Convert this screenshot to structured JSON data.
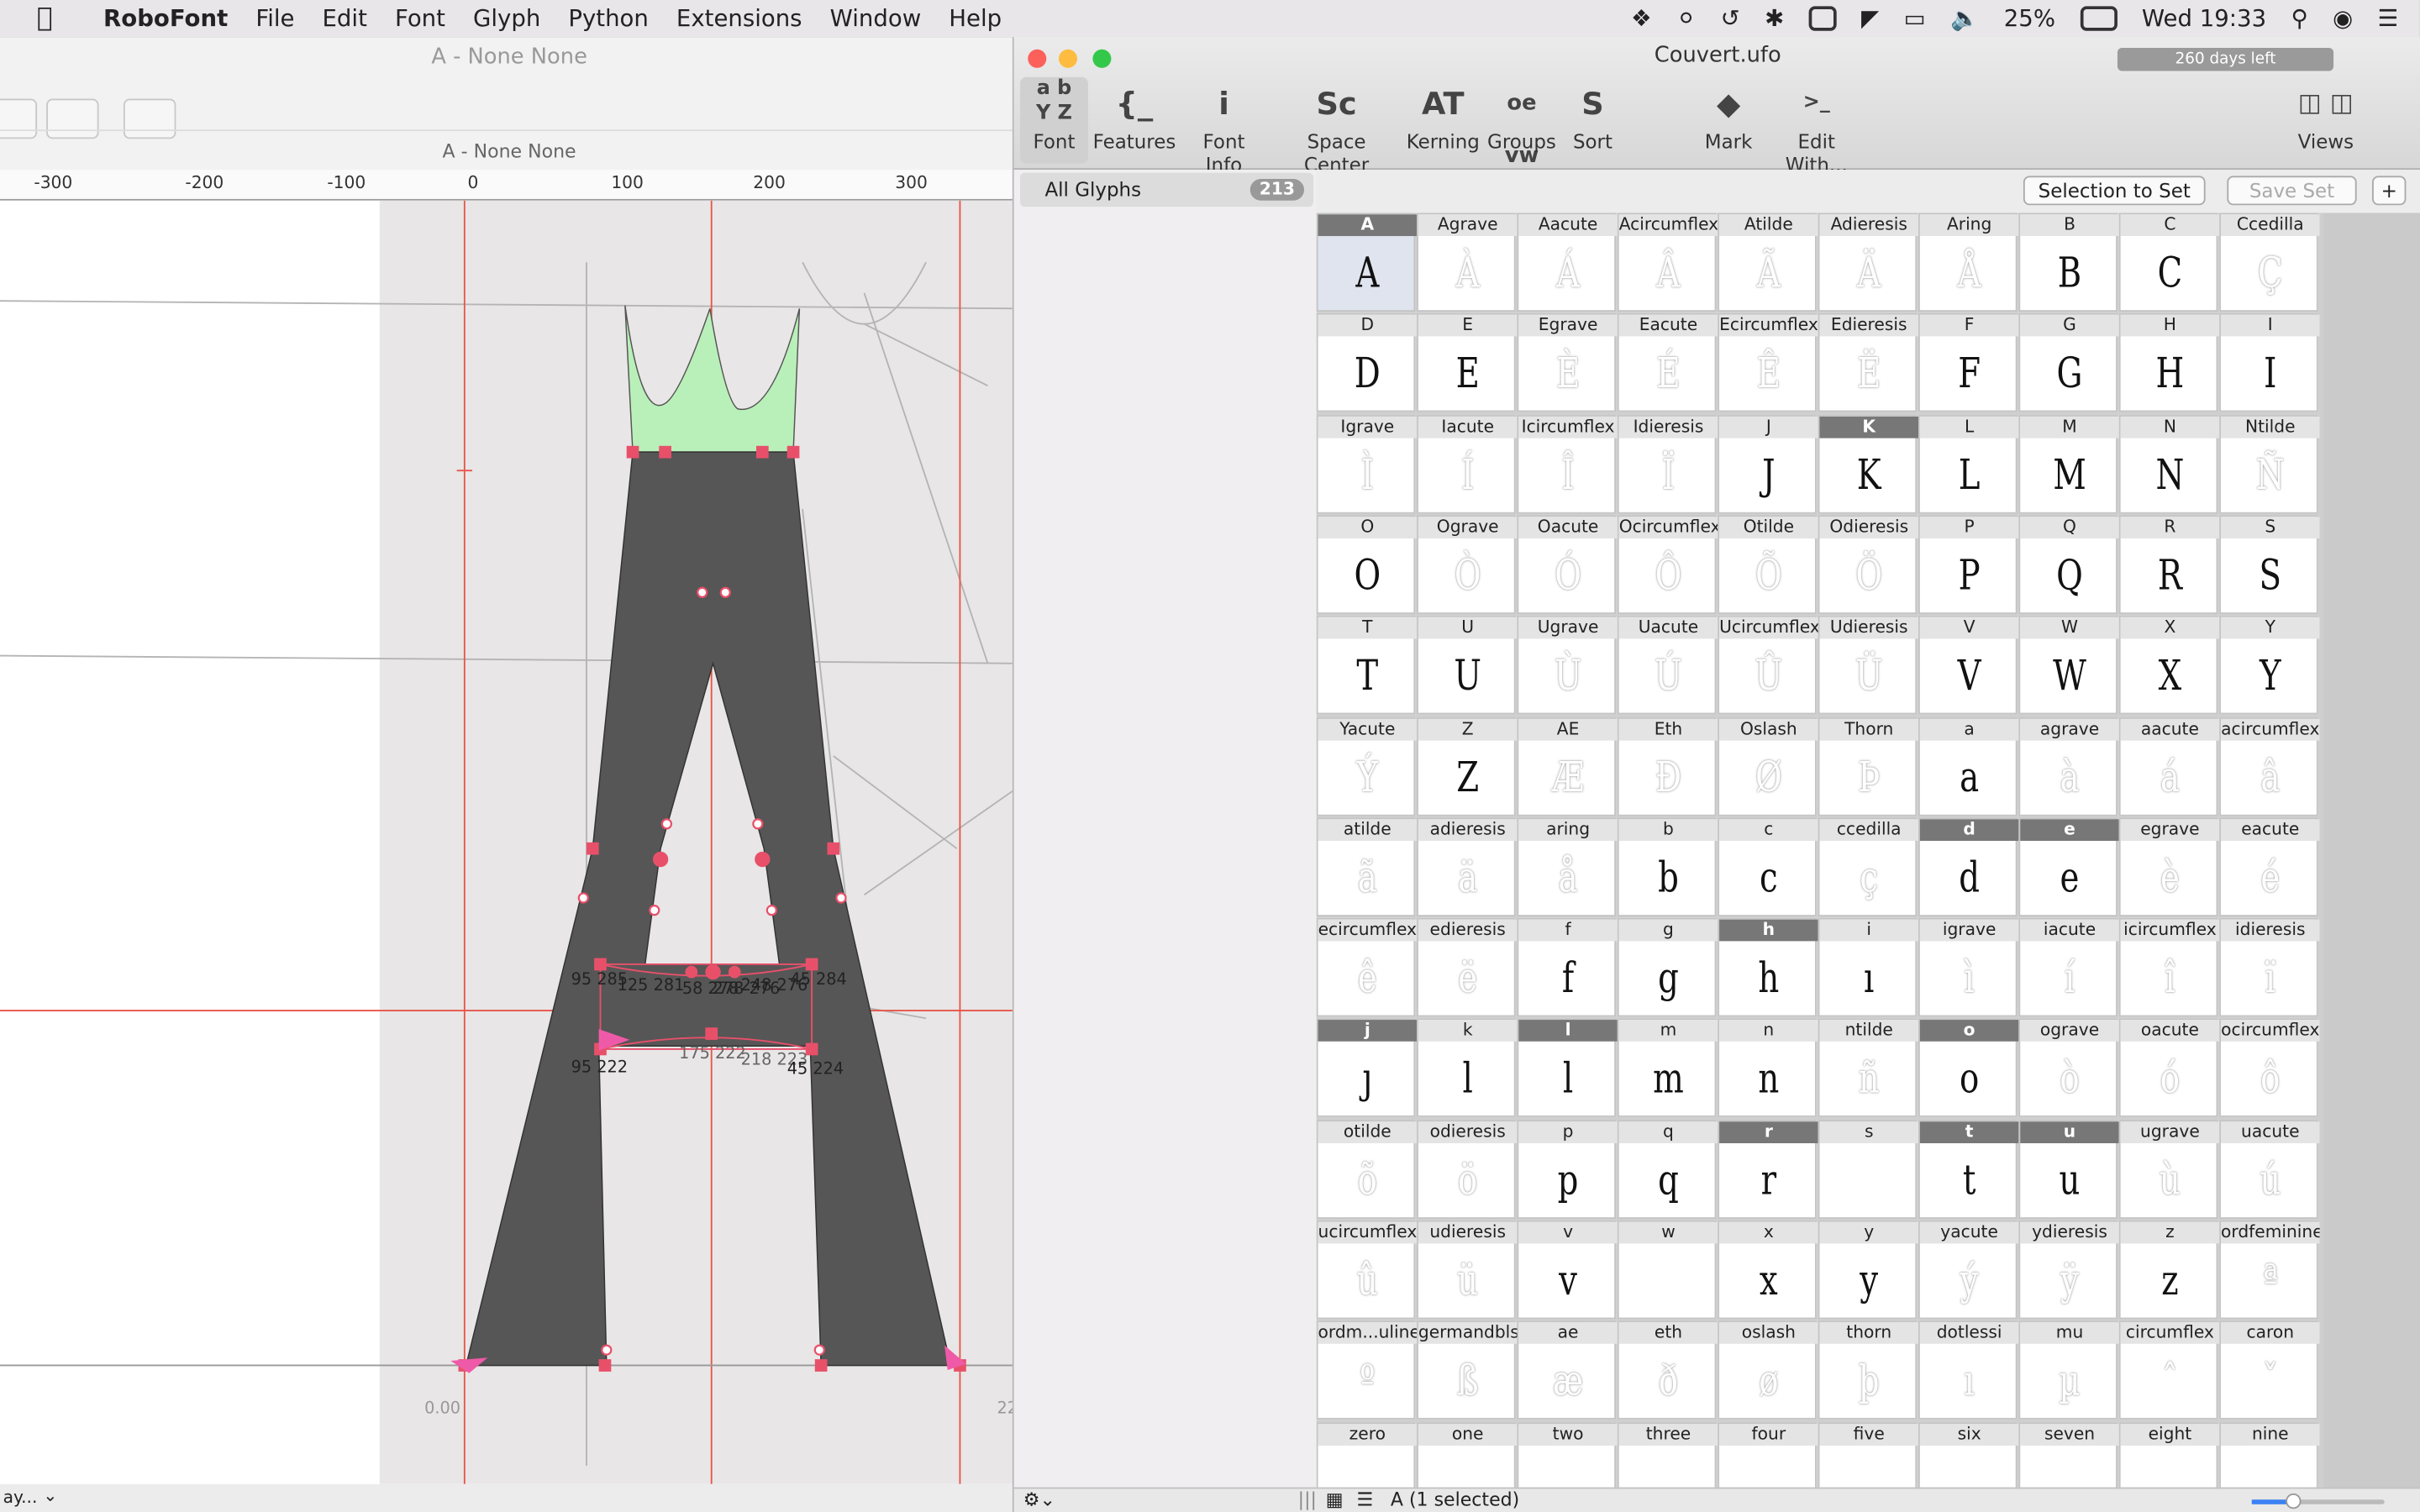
{
  "menubar": {
    "app": "RoboFont",
    "items": [
      "File",
      "Edit",
      "Font",
      "Glyph",
      "Python",
      "Extensions",
      "Window",
      "Help"
    ],
    "battery": "25%",
    "clock": "Wed 19:33"
  },
  "glyph_window": {
    "title": "A - None None",
    "subtitle": "A - None None",
    "ruler_ticks": [
      "-300",
      "-200",
      "-100",
      "0",
      "100",
      "200",
      "300"
    ],
    "origin_label": "0.00",
    "right_label": "22",
    "coord_labels": [
      "95 285",
      "125 281",
      "58 278",
      "278 276",
      "248 276",
      "45 284",
      "95 222",
      "175 222",
      "218 223",
      "45 224"
    ],
    "status_text": "ay..."
  },
  "font_window": {
    "title": "Couvert.ufo",
    "trial": "260 days left",
    "toolbar": [
      {
        "label": "Font",
        "icon": "a b\nY Z"
      },
      {
        "label": "Features",
        "icon": "{_"
      },
      {
        "label": "Font Info",
        "icon": "i"
      },
      {
        "label": "Space Center",
        "icon": "Sc"
      },
      {
        "label": "Kerning",
        "icon": "AT"
      },
      {
        "label": "Groups",
        "icon": "oe vw"
      },
      {
        "label": "Sort",
        "icon": "S"
      },
      {
        "label": "Mark",
        "icon": "tag"
      },
      {
        "label": "Edit With...",
        "icon": ">_"
      },
      {
        "label": "Views",
        "icon": "views"
      }
    ],
    "sidebar": {
      "all_glyphs": "All Glyphs",
      "count": "213"
    },
    "selection_to_set": "Selection to Set",
    "save_set": "Save Set",
    "add_set": "+",
    "status": "A (1 selected)",
    "glyphs": [
      [
        "A",
        "A"
      ],
      [
        "Agrave",
        "À"
      ],
      [
        "Aacute",
        "Á"
      ],
      [
        "Acircumflex",
        "Â"
      ],
      [
        "Atilde",
        "Ã"
      ],
      [
        "Adieresis",
        "Ä"
      ],
      [
        "Aring",
        "Å"
      ],
      [
        "B",
        "B"
      ],
      [
        "C",
        "C"
      ],
      [
        "Ccedilla",
        "Ç"
      ],
      [
        "D",
        "D"
      ],
      [
        "E",
        "E"
      ],
      [
        "Egrave",
        "È"
      ],
      [
        "Eacute",
        "É"
      ],
      [
        "Ecircumflex",
        "Ê"
      ],
      [
        "Edieresis",
        "Ë"
      ],
      [
        "F",
        "F"
      ],
      [
        "G",
        "G"
      ],
      [
        "H",
        "H"
      ],
      [
        "I",
        "I"
      ],
      [
        "Igrave",
        "Ì"
      ],
      [
        "Iacute",
        "Í"
      ],
      [
        "Icircumflex",
        "Î"
      ],
      [
        "Idieresis",
        "Ï"
      ],
      [
        "J",
        "J"
      ],
      [
        "K",
        "K"
      ],
      [
        "L",
        "L"
      ],
      [
        "M",
        "M"
      ],
      [
        "N",
        "N"
      ],
      [
        "Ntilde",
        "Ñ"
      ],
      [
        "O",
        "O"
      ],
      [
        "Ograve",
        "Ò"
      ],
      [
        "Oacute",
        "Ó"
      ],
      [
        "Ocircumflex",
        "Ô"
      ],
      [
        "Otilde",
        "Õ"
      ],
      [
        "Odieresis",
        "Ö"
      ],
      [
        "P",
        "P"
      ],
      [
        "Q",
        "Q"
      ],
      [
        "R",
        "R"
      ],
      [
        "S",
        "S"
      ],
      [
        "T",
        "T"
      ],
      [
        "U",
        "U"
      ],
      [
        "Ugrave",
        "Ù"
      ],
      [
        "Uacute",
        "Ú"
      ],
      [
        "Ucircumflex",
        "Û"
      ],
      [
        "Udieresis",
        "Ü"
      ],
      [
        "V",
        "V"
      ],
      [
        "W",
        "W"
      ],
      [
        "X",
        "X"
      ],
      [
        "Y",
        "Y"
      ],
      [
        "Yacute",
        "Ý"
      ],
      [
        "Z",
        "Z"
      ],
      [
        "AE",
        "Æ"
      ],
      [
        "Eth",
        "Ð"
      ],
      [
        "Oslash",
        "Ø"
      ],
      [
        "Thorn",
        "Þ"
      ],
      [
        "a",
        "a"
      ],
      [
        "agrave",
        "à"
      ],
      [
        "aacute",
        "á"
      ],
      [
        "acircumflex",
        "â"
      ],
      [
        "atilde",
        "ã"
      ],
      [
        "adieresis",
        "ä"
      ],
      [
        "aring",
        "å"
      ],
      [
        "b",
        "b"
      ],
      [
        "c",
        "c"
      ],
      [
        "ccedilla",
        "ç"
      ],
      [
        "d",
        "d"
      ],
      [
        "e",
        "e"
      ],
      [
        "egrave",
        "è"
      ],
      [
        "eacute",
        "é"
      ],
      [
        "ecircumflex",
        "ê"
      ],
      [
        "edieresis",
        "ë"
      ],
      [
        "f",
        "f"
      ],
      [
        "g",
        "g"
      ],
      [
        "h",
        "h"
      ],
      [
        "i",
        "ı"
      ],
      [
        "igrave",
        "ì"
      ],
      [
        "iacute",
        "í"
      ],
      [
        "icircumflex",
        "î"
      ],
      [
        "idieresis",
        "ï"
      ],
      [
        "j",
        "ȷ"
      ],
      [
        "k",
        "l"
      ],
      [
        "l",
        "l"
      ],
      [
        "m",
        "m"
      ],
      [
        "n",
        "n"
      ],
      [
        "ntilde",
        "ñ"
      ],
      [
        "o",
        "o"
      ],
      [
        "ograve",
        "ò"
      ],
      [
        "oacute",
        "ó"
      ],
      [
        "ocircumflex",
        "ô"
      ],
      [
        "otilde",
        "õ"
      ],
      [
        "odieresis",
        "ö"
      ],
      [
        "p",
        "p"
      ],
      [
        "q",
        "q"
      ],
      [
        "r",
        "r"
      ],
      [
        "s",
        ""
      ],
      [
        "t",
        "t"
      ],
      [
        "u",
        "u"
      ],
      [
        "ugrave",
        "ù"
      ],
      [
        "uacute",
        "ú"
      ],
      [
        "ucircumflex",
        "û"
      ],
      [
        "udieresis",
        "ü"
      ],
      [
        "v",
        "v"
      ],
      [
        "w",
        ""
      ],
      [
        "x",
        "x"
      ],
      [
        "y",
        "y"
      ],
      [
        "yacute",
        "ý"
      ],
      [
        "ydieresis",
        "ÿ"
      ],
      [
        "z",
        "z"
      ],
      [
        "ordfeminine",
        "ª"
      ],
      [
        "ordm...uline",
        "º"
      ],
      [
        "germandbls",
        "ß"
      ],
      [
        "ae",
        "æ"
      ],
      [
        "eth",
        "ð"
      ],
      [
        "oslash",
        "ø"
      ],
      [
        "thorn",
        "þ"
      ],
      [
        "dotlessi",
        "ı"
      ],
      [
        "mu",
        "µ"
      ],
      [
        "circumflex",
        "ˆ"
      ],
      [
        "caron",
        "ˇ"
      ],
      [
        "zero",
        ""
      ],
      [
        "one",
        ""
      ],
      [
        "two",
        ""
      ],
      [
        "three",
        ""
      ],
      [
        "four",
        ""
      ],
      [
        "five",
        ""
      ],
      [
        "six",
        ""
      ],
      [
        "seven",
        ""
      ],
      [
        "eight",
        ""
      ],
      [
        "nine",
        ""
      ]
    ],
    "selected_glyphs": [
      "K",
      "d",
      "e",
      "h",
      "j",
      "l",
      "o",
      "r",
      "t",
      "u"
    ],
    "ghost_glyphs": [
      "Agrave",
      "Aacute",
      "Acircumflex",
      "Atilde",
      "Adieresis",
      "Aring",
      "Ccedilla",
      "Egrave",
      "Eacute",
      "Ecircumflex",
      "Edieresis",
      "Igrave",
      "Iacute",
      "Icircumflex",
      "Idieresis",
      "Ntilde",
      "Ograve",
      "Oacute",
      "Ocircumflex",
      "Otilde",
      "Odieresis",
      "Ugrave",
      "Uacute",
      "Ucircumflex",
      "Udieresis",
      "Yacute",
      "AE",
      "Eth",
      "Oslash",
      "Thorn",
      "agrave",
      "aacute",
      "acircumflex",
      "atilde",
      "adieresis",
      "aring",
      "ccedilla",
      "egrave",
      "eacute",
      "ecircumflex",
      "edieresis",
      "igrave",
      "iacute",
      "icircumflex",
      "idieresis",
      "ntilde",
      "ograve",
      "oacute",
      "ocircumflex",
      "otilde",
      "odieresis",
      "ugrave",
      "uacute",
      "ucircumflex",
      "udieresis",
      "yacute",
      "ydieresis",
      "ordfeminine",
      "ordm...uline",
      "germandbls",
      "ae",
      "eth",
      "oslash",
      "thorn",
      "dotlessi",
      "mu",
      "circumflex",
      "caron"
    ]
  },
  "colors": {
    "glyph_fill": "#565656",
    "serif_fill": "#b9f0b9",
    "point": "#e8506a",
    "guide": "#e8554a"
  }
}
